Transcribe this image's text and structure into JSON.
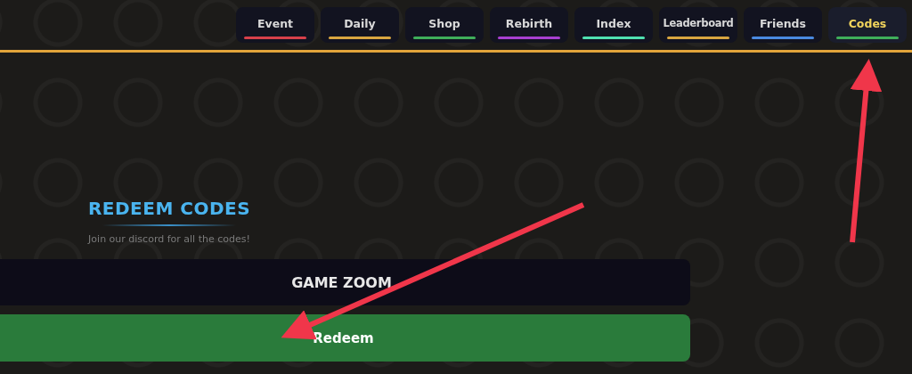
{
  "tabs": [
    {
      "label": "Event",
      "color": "#d8404a",
      "selected": false
    },
    {
      "label": "Daily",
      "color": "#d9a640",
      "selected": false
    },
    {
      "label": "Shop",
      "color": "#3fae5a",
      "selected": false
    },
    {
      "label": "Rebirth",
      "color": "#a83fd0",
      "selected": false
    },
    {
      "label": "Index",
      "color": "#4fe0b0",
      "selected": false
    },
    {
      "label": "Leaderboard",
      "color": "#d9a640",
      "selected": false
    },
    {
      "label": "Friends",
      "color": "#4a8ae0",
      "selected": false
    },
    {
      "label": "Codes",
      "color": "#3fae5a",
      "selected": true
    }
  ],
  "redeem": {
    "title": "REDEEM CODES",
    "subtitle": "Join our discord for all the codes!",
    "code_field": {
      "value": "GAME ZOOM"
    },
    "button": "Redeem"
  }
}
